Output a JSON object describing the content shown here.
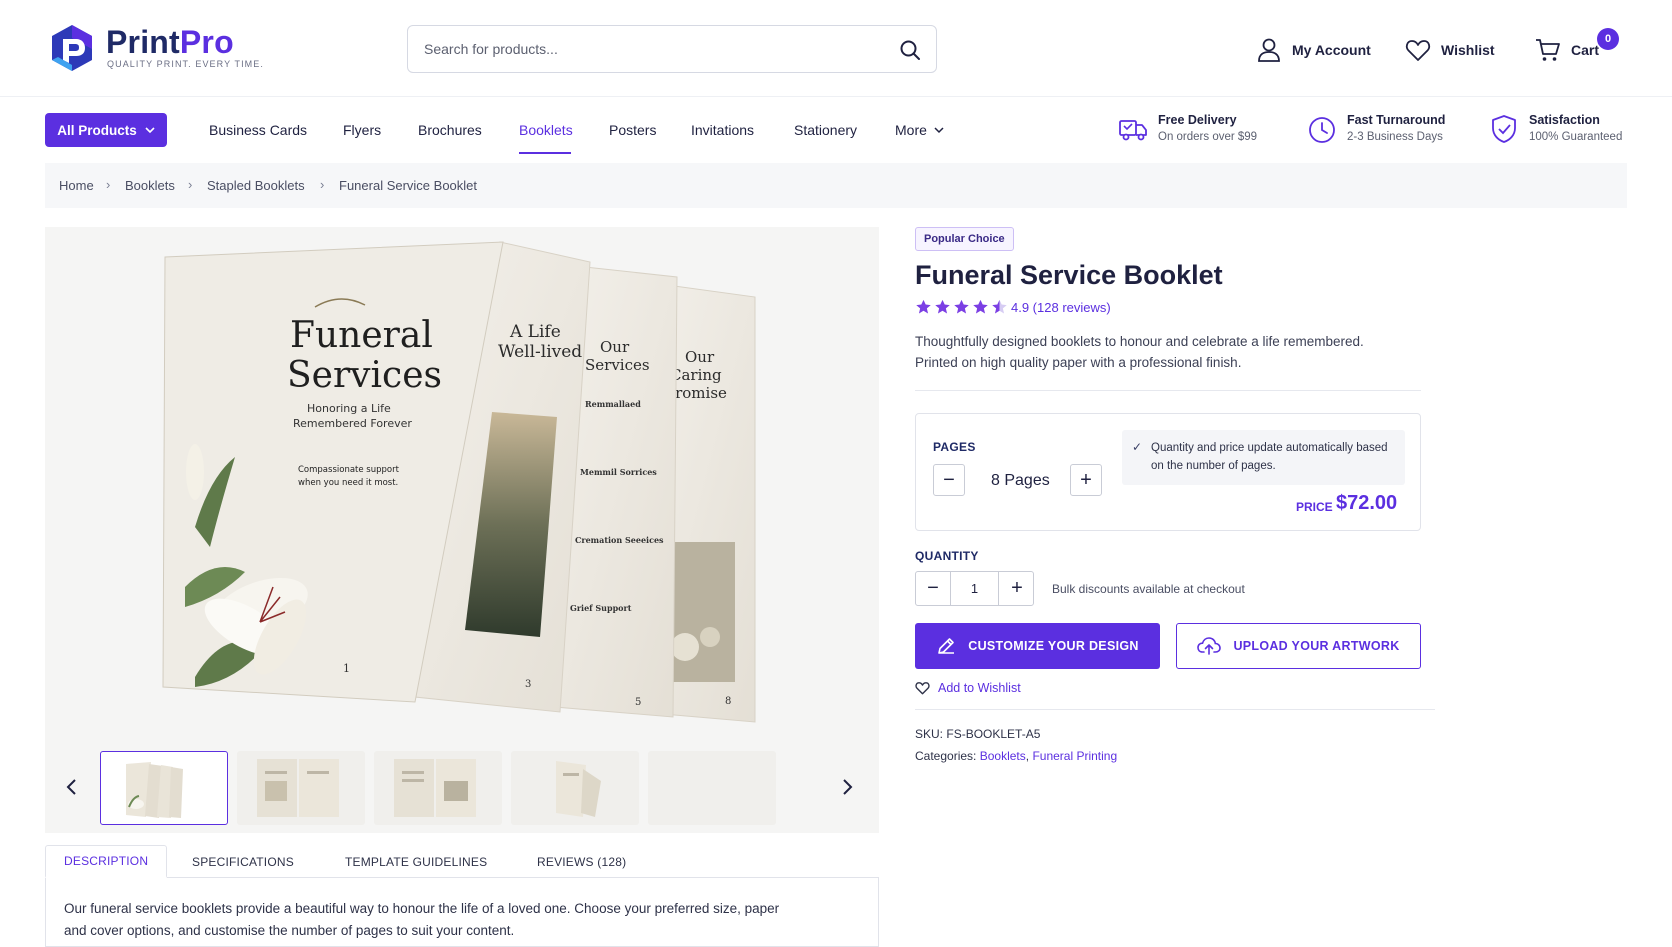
{
  "brand": {
    "name_a": "Print",
    "name_b": "Pro",
    "tagline": "QUALITY PRINT. EVERY TIME.",
    "accent": "#5b2fe0"
  },
  "search": {
    "placeholder": "Search for products..."
  },
  "header": {
    "account": "My Account",
    "wishlist": "Wishlist",
    "cart": "Cart",
    "cart_count": "0"
  },
  "nav": {
    "all_products": "All Products",
    "items": [
      "Business Cards",
      "Flyers",
      "Brochures",
      "Booklets",
      "Posters",
      "Invitations",
      "Stationery",
      "More"
    ],
    "active": "Booklets"
  },
  "features": [
    {
      "title": "Free Delivery",
      "sub": "On orders over $99",
      "icon": "truck-icon"
    },
    {
      "title": "Fast Turnaround",
      "sub": "2-3 Business Days",
      "icon": "clock-icon"
    },
    {
      "title": "Satisfaction",
      "sub": "100% Guaranteed",
      "icon": "shield-check-icon"
    }
  ],
  "breadcrumb": [
    "Home",
    "Booklets",
    "Stapled Booklets",
    "Funeral Service Booklet"
  ],
  "gallery": {
    "cover_title_line1": "Funeral",
    "cover_title_line2": "Services",
    "cover_sub_line1": "Honoring a Life",
    "cover_sub_line2": "Remembered Forever",
    "cover_note_line1": "Compassionate support",
    "cover_note_line2": "when you need it most.",
    "page2_line1": "A Life",
    "page2_line2": "Well-lived",
    "page3_line1": "Our",
    "page3_line2": "Services",
    "page3_items": [
      "Remmallaed",
      "Memmil Sorrices",
      "Cremation Seeeices",
      "Grief Support"
    ],
    "page4_line1": "Our",
    "page4_line2": "Caring",
    "page4_line3": "Promise",
    "page_numbers": [
      "1",
      "3",
      "5",
      "8"
    ]
  },
  "product": {
    "badge": "Popular Choice",
    "title": "Funeral Service Booklet",
    "rating": 4.5,
    "rating_text": "4.9 (128 reviews)",
    "description_line1": "Thoughtfully designed booklets to honour and celebrate a life remembered.",
    "description_line2": "Printed on high quality paper with a professional finish.",
    "pages_label": "PAGES",
    "pages_value": "8 Pages",
    "note": "Quantity and price update automatically based on the number of pages.",
    "price_label": "PRICE",
    "price": "$72.00",
    "quantity_label": "QUANTITY",
    "quantity": "1",
    "bulk_note": "Bulk discounts available at checkout",
    "customize_button": "CUSTOMIZE YOUR DESIGN",
    "upload_button": "UPLOAD YOUR ARTWORK",
    "wishlist_link": "Add to Wishlist",
    "sku_label": "SKU:",
    "sku": "FS-BOOKLET-A5",
    "categories_label": "Categories:",
    "categories": [
      "Booklets",
      "Funeral Printing"
    ],
    "category_separator": ","
  },
  "tabs": {
    "items": [
      "DESCRIPTION",
      "SPECIFICATIONS",
      "TEMPLATE GUIDELINES",
      "REVIEWS (128)"
    ],
    "active": "DESCRIPTION",
    "text_line1": "Our funeral service booklets provide a beautiful way to honour the life of a loved one. Choose your preferred size, paper",
    "text_line2": "and cover options, and customise the number of pages to suit your content."
  }
}
